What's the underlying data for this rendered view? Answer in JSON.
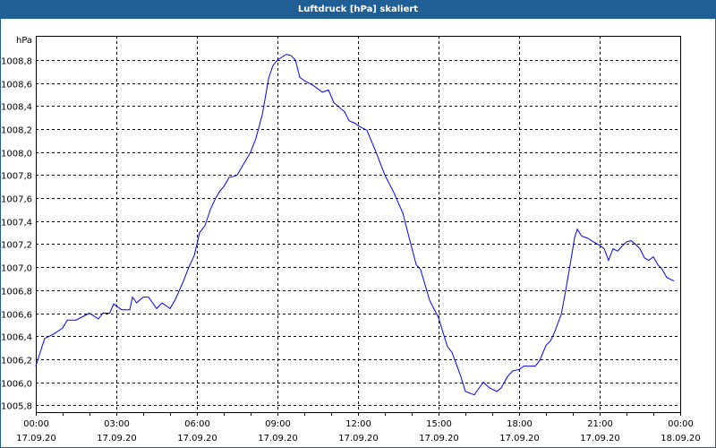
{
  "window": {
    "title": "Luftdruck [hPa] skaliert"
  },
  "chart_data": {
    "type": "line",
    "title": "Luftdruck [hPa] skaliert",
    "ylabel": "hPa",
    "xlabel": "",
    "xlim_hours": [
      0,
      24
    ],
    "ylim": [
      1005.74,
      1009.01
    ],
    "grid": true,
    "line_color": "#0000ff",
    "y_ticks": [
      1005.8,
      1006.0,
      1006.2,
      1006.4,
      1006.6,
      1006.8,
      1007.0,
      1007.2,
      1007.4,
      1007.6,
      1007.8,
      1008.0,
      1008.2,
      1008.4,
      1008.6,
      1008.8
    ],
    "y_tick_labels": [
      "1005,8",
      "1006,0",
      "1006,2",
      "1006,4",
      "1006,6",
      "1006,8",
      "1007,0",
      "1007,2",
      "1007,4",
      "1007,6",
      "1007,8",
      "1008,0",
      "1008,2",
      "1008,4",
      "1008,6",
      "1008,8"
    ],
    "x_ticks": [
      {
        "hour": 0,
        "time": "00:00",
        "date": "17.09.20"
      },
      {
        "hour": 3,
        "time": "03:00",
        "date": "17.09.20"
      },
      {
        "hour": 6,
        "time": "06:00",
        "date": "17.09.20"
      },
      {
        "hour": 9,
        "time": "09:00",
        "date": "17.09.20"
      },
      {
        "hour": 12,
        "time": "12:00",
        "date": "17.09.20"
      },
      {
        "hour": 15,
        "time": "15:00",
        "date": "17.09.20"
      },
      {
        "hour": 18,
        "time": "18:00",
        "date": "17.09.20"
      },
      {
        "hour": 21,
        "time": "21:00",
        "date": "17.09.20"
      },
      {
        "hour": 24,
        "time": "00:00",
        "date": "18.09.20"
      }
    ],
    "series": [
      {
        "name": "Luftdruck",
        "x_hours": [
          0,
          0.33,
          0.67,
          1.0,
          1.17,
          1.5,
          2.0,
          2.33,
          2.5,
          2.75,
          2.9,
          3.2,
          3.5,
          3.6,
          3.75,
          4.0,
          4.2,
          4.5,
          4.7,
          5.0,
          5.2,
          5.5,
          5.7,
          5.9,
          6.0,
          6.1,
          6.3,
          6.5,
          6.7,
          6.85,
          7.0,
          7.2,
          7.4,
          7.5,
          7.8,
          8.0,
          8.2,
          8.44,
          8.67,
          8.83,
          9.0,
          9.33,
          9.5,
          9.67,
          9.83,
          10.0,
          10.33,
          10.67,
          10.9,
          11.1,
          11.5,
          11.67,
          11.9,
          12.0,
          12.33,
          12.67,
          13.0,
          13.33,
          13.67,
          13.9,
          14.17,
          14.33,
          14.67,
          15.0,
          15.33,
          15.5,
          15.83,
          16.0,
          16.33,
          16.57,
          16.67,
          16.9,
          17.17,
          17.33,
          17.57,
          17.77,
          18.0,
          18.17,
          18.6,
          18.77,
          19.0,
          19.17,
          19.33,
          19.57,
          19.73,
          19.9,
          20.07,
          20.17,
          20.33,
          20.57,
          20.77,
          21.0,
          21.17,
          21.33,
          21.5,
          21.67,
          21.83,
          22.0,
          22.17,
          22.33,
          22.5,
          22.67,
          22.83,
          23.0,
          23.17,
          23.33,
          23.5,
          23.77
        ],
        "values": [
          1006.14,
          1006.38,
          1006.42,
          1006.47,
          1006.54,
          1006.54,
          1006.6,
          1006.55,
          1006.6,
          1006.6,
          1006.68,
          1006.63,
          1006.63,
          1006.74,
          1006.69,
          1006.74,
          1006.74,
          1006.64,
          1006.69,
          1006.64,
          1006.72,
          1006.88,
          1007.0,
          1007.1,
          1007.2,
          1007.3,
          1007.36,
          1007.5,
          1007.6,
          1007.66,
          1007.7,
          1007.78,
          1007.79,
          1007.8,
          1007.92,
          1008.0,
          1008.12,
          1008.33,
          1008.64,
          1008.75,
          1008.8,
          1008.85,
          1008.84,
          1008.8,
          1008.65,
          1008.62,
          1008.58,
          1008.52,
          1008.54,
          1008.43,
          1008.35,
          1008.27,
          1008.25,
          1008.23,
          1008.19,
          1008.0,
          1007.8,
          1007.65,
          1007.47,
          1007.26,
          1007.02,
          1006.98,
          1006.71,
          1006.56,
          1006.31,
          1006.26,
          1006.05,
          1005.92,
          1005.89,
          1005.97,
          1006.0,
          1005.95,
          1005.92,
          1005.95,
          1006.05,
          1006.1,
          1006.11,
          1006.14,
          1006.14,
          1006.19,
          1006.32,
          1006.36,
          1006.44,
          1006.59,
          1006.79,
          1007.02,
          1007.26,
          1007.33,
          1007.27,
          1007.25,
          1007.22,
          1007.19,
          1007.16,
          1007.06,
          1007.16,
          1007.14,
          1007.18,
          1007.22,
          1007.23,
          1007.2,
          1007.16,
          1007.08,
          1007.06,
          1007.09,
          1007.02,
          1006.98,
          1006.91,
          1006.88
        ]
      }
    ]
  }
}
